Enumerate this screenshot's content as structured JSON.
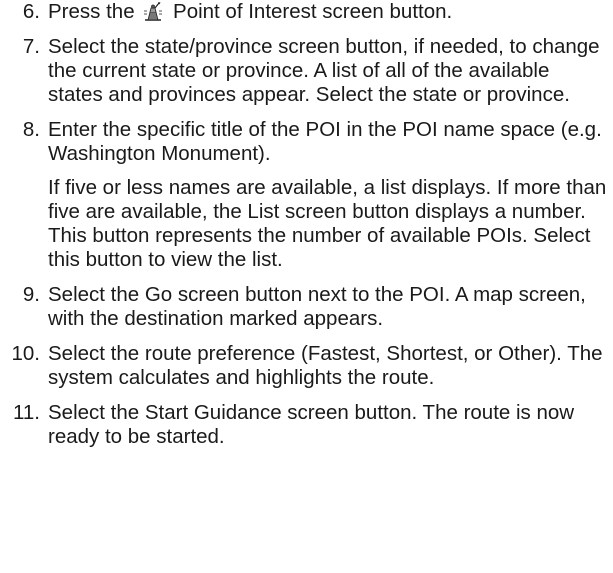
{
  "steps": [
    {
      "number": "6.",
      "before_icon": "Press the",
      "icon": "point-of-interest-icon",
      "after_icon": " Point of Interest screen button."
    },
    {
      "number": "7.",
      "paragraphs": [
        "Select the state/province screen button, if needed, to change the current state or province. A list of all of the available states and provinces appear. Select the state or province."
      ]
    },
    {
      "number": "8.",
      "paragraphs": [
        "Enter the specific title of the POI in the POI name space (e.g. Washington Monument).",
        "If five or less names are available, a list displays. If more than five are available, the List screen button displays a number. This button represents the number of available POIs. Select this button to view the list."
      ]
    },
    {
      "number": "9.",
      "paragraphs": [
        "Select the Go screen button next to the POI. A map screen, with the destination marked appears."
      ]
    },
    {
      "number": "10.",
      "paragraphs": [
        "Select the route preference (Fastest, Shortest, or Other). The system calculates and highlights the route."
      ]
    },
    {
      "number": "11.",
      "paragraphs": [
        "Select the Start Guidance screen button. The route is now ready to be started."
      ]
    }
  ]
}
